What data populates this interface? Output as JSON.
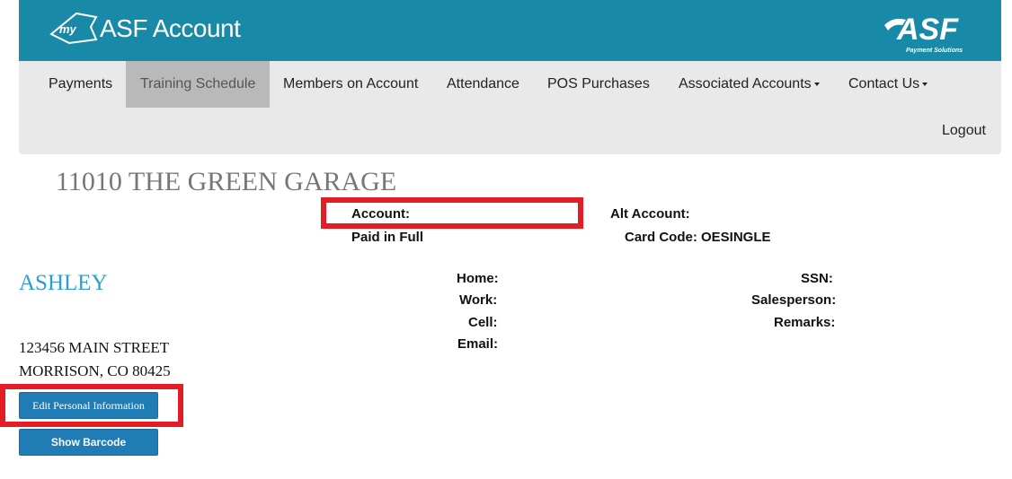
{
  "header": {
    "brand_title": "ASF Account",
    "brand_logo_text": "my",
    "corner_logo_text": "ASF",
    "corner_logo_tagline": "Payment Solutions"
  },
  "nav": {
    "items": [
      {
        "label": "Payments"
      },
      {
        "label": "Training Schedule",
        "active": true
      },
      {
        "label": "Members on Account"
      },
      {
        "label": "Attendance"
      },
      {
        "label": "POS Purchases"
      },
      {
        "label": "Associated Accounts",
        "dropdown": true
      },
      {
        "label": "Contact Us",
        "dropdown": true
      }
    ],
    "logout": "Logout"
  },
  "account": {
    "org_name": "11010 THE GREEN GARAGE",
    "account_label": "Account:",
    "alt_account_label": "Alt Account:",
    "status": "Paid in Full",
    "card_code": "Card Code: OESINGLE"
  },
  "member": {
    "name": "ASHLEY",
    "address_line1": "123456 MAIN STREET",
    "address_line2": "MORRISON, CO 80425",
    "contact_labels": {
      "home": "Home:",
      "work": "Work:",
      "cell": "Cell:",
      "email": "Email:"
    },
    "other_labels": {
      "ssn": "SSN:",
      "salesperson": "Salesperson:",
      "remarks": "Remarks:"
    }
  },
  "buttons": {
    "edit_personal": "Edit Personal Information",
    "show_barcode": "Show Barcode"
  },
  "colors": {
    "header_bg": "#1889a7",
    "nav_bg": "#e9e9e9",
    "nav_active_bg": "#b9b9b9",
    "highlight_red": "#e21d26",
    "name_blue": "#2a9fd3",
    "button_blue": "#1f7cb4"
  },
  "icons": {
    "brand_logo": "my-asf-logo-icon",
    "corner_logo": "asf-payment-solutions-logo-icon"
  }
}
